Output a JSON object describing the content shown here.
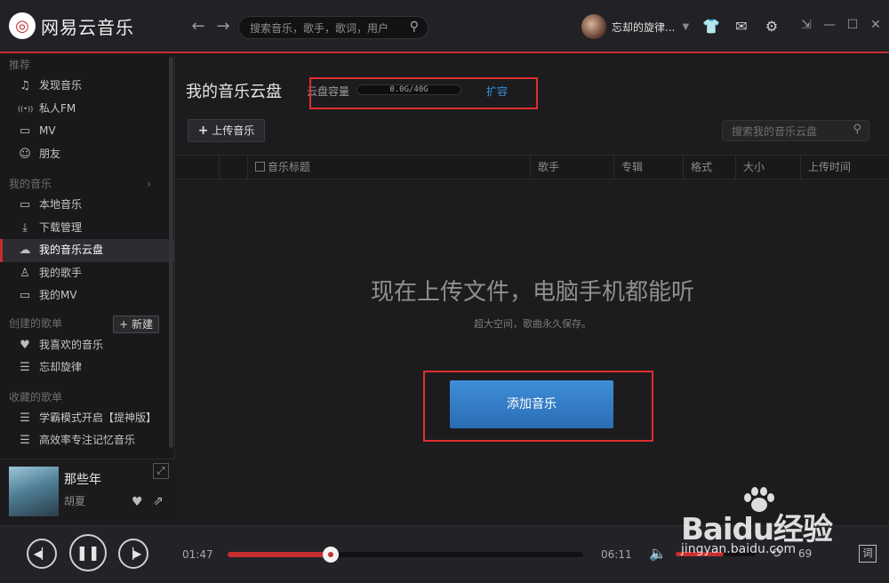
{
  "app": {
    "logo_text": "网易云音乐",
    "search": {
      "placeholder": "搜索音乐，歌手，歌词，用户"
    },
    "user": {
      "name": "忘却的旋律..."
    },
    "icons": [
      "skin-icon",
      "mail-icon",
      "settings-icon"
    ],
    "accent_color": "#c62f2f"
  },
  "sidebar": {
    "recommend_title": "推荐",
    "recommend_items": [
      {
        "label": "发现音乐",
        "icon": "music-note-icon",
        "glyph": "♫"
      },
      {
        "label": "私人FM",
        "icon": "radio-icon",
        "glyph": "((•))"
      },
      {
        "label": "MV",
        "icon": "mv-icon",
        "glyph": "▭"
      },
      {
        "label": "朋友",
        "icon": "friends-icon",
        "glyph": "☺"
      }
    ],
    "mymusic_title": "我的音乐",
    "mymusic_items": [
      {
        "label": "本地音乐",
        "icon": "monitor-icon",
        "glyph": "▭"
      },
      {
        "label": "下载管理",
        "icon": "download-icon",
        "glyph": "⤓"
      },
      {
        "label": "我的音乐云盘",
        "icon": "cloud-icon",
        "glyph": "☁",
        "active": true
      },
      {
        "label": "我的歌手",
        "icon": "singer-icon",
        "glyph": "♙"
      },
      {
        "label": "我的MV",
        "icon": "mv-icon",
        "glyph": "▭"
      }
    ],
    "created_title": "创建的歌单",
    "new_button": "+ 新建",
    "created_items": [
      {
        "label": "我喜欢的音乐",
        "icon": "heart-icon",
        "glyph": "♥"
      },
      {
        "label": "忘却旋律",
        "icon": "playlist-icon",
        "glyph": "☰"
      }
    ],
    "collected_title": "收藏的歌单",
    "collected_items": [
      {
        "label": "学霸模式开启【提神版】",
        "icon": "playlist-icon",
        "glyph": "☰"
      },
      {
        "label": "高效率专注记忆音乐",
        "icon": "playlist-icon",
        "glyph": "☰"
      }
    ],
    "now_playing": {
      "title": "那些年",
      "artist": "胡夏"
    }
  },
  "main": {
    "title": "我的音乐云盘",
    "capacity_label": "云盘容量",
    "capacity_value": "0.0G/40G",
    "expand_link": "扩容",
    "upload_button": "上传音乐",
    "search_placeholder": "搜索我的音乐云盘",
    "columns": [
      "音乐标题",
      "歌手",
      "专辑",
      "格式",
      "大小",
      "上传时间"
    ],
    "empty_title": "现在上传文件，电脑手机都能听",
    "empty_subtitle": "超大空间，歌曲永久保存。",
    "add_button": "添加音乐"
  },
  "player": {
    "current_time": "01:47",
    "total_time": "06:11",
    "progress_fraction": 0.29,
    "volume_fraction": 0.6,
    "play_count": "69",
    "lyric_button": "词"
  },
  "watermark": {
    "main": "Baidu经验",
    "sub": "jingyan.baidu.com"
  }
}
